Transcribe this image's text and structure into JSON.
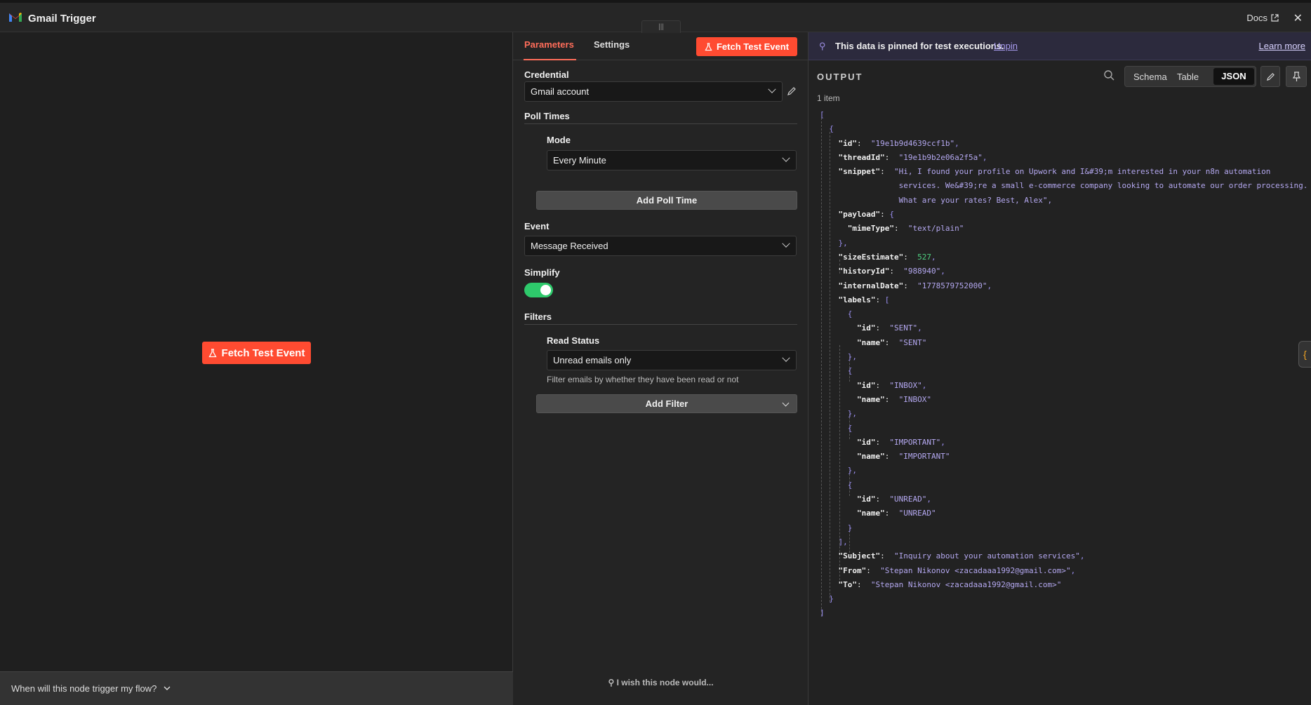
{
  "header": {
    "title": "Gmail Trigger",
    "docs_label": "Docs"
  },
  "left_panel": {
    "fetch_button": "Fetch Test Event",
    "trigger_help": "When will this node trigger my flow?"
  },
  "params": {
    "tabs": [
      "Parameters",
      "Settings"
    ],
    "fetch_button": "Fetch Test Event",
    "credential_label": "Credential",
    "credential_value": "Gmail account",
    "poll_times_label": "Poll Times",
    "mode_label": "Mode",
    "mode_value": "Every Minute",
    "add_poll_time": "Add Poll Time",
    "event_label": "Event",
    "event_value": "Message Received",
    "simplify_label": "Simplify",
    "simplify_on": true,
    "filters_label": "Filters",
    "read_status_label": "Read Status",
    "read_status_value": "Unread emails only",
    "read_status_hint": "Filter emails by whether they have been read or not",
    "add_filter": "Add Filter",
    "wish": "I wish this node would..."
  },
  "output": {
    "banner_msg": "This data is pinned for test executions.",
    "unpin": "Unpin",
    "learn_more": "Learn more",
    "title": "OUTPUT",
    "item_count": "1 item",
    "views": [
      "Schema",
      "Table",
      "JSON"
    ],
    "active_view": "JSON",
    "json": {
      "id": "19e1b9d4639ccf1b",
      "threadId": "19e1b9b2e06a2f5a",
      "snippet_lines": [
        "\"Hi, I found your profile on Upwork and I&#39;m interested in your n8n automation",
        "services. We&#39;re a small e-commerce company looking to automate our order processing.",
        "What are your rates? Best, Alex\","
      ],
      "mimeType": "text/plain",
      "sizeEstimate": "527",
      "historyId": "988940",
      "internalDate": "1778579752000",
      "labels": [
        "SENT",
        "INBOX",
        "IMPORTANT",
        "UNREAD"
      ],
      "Subject": "Inquiry about your automation services",
      "From": "Stepan Nikonov <zacadaaa1992@gmail.com>",
      "To": "Stepan Nikonov <zacadaaa1992@gmail.com>"
    }
  }
}
